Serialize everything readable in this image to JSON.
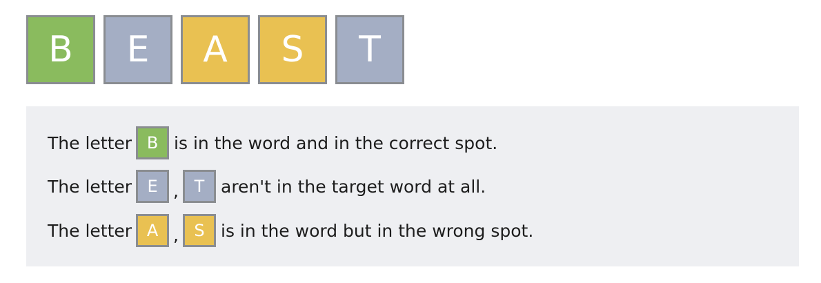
{
  "board": {
    "tiles": [
      {
        "letter": "B",
        "state": "correct"
      },
      {
        "letter": "E",
        "state": "absent"
      },
      {
        "letter": "A",
        "state": "present"
      },
      {
        "letter": "S",
        "state": "present"
      },
      {
        "letter": "T",
        "state": "absent"
      }
    ]
  },
  "colors": {
    "correct": "#8abb5e",
    "absent": "#a4aec4",
    "present": "#e9c152",
    "tile_border": "#8a8d91",
    "legend_bg": "#eeeff2"
  },
  "legend": {
    "correct": {
      "prefix": "The letter",
      "letters": [
        "B"
      ],
      "text": "is in the word and in the correct spot."
    },
    "absent": {
      "prefix": "The letter",
      "letters": [
        "E",
        "T"
      ],
      "separator": ",",
      "text": "aren't in the target word at all."
    },
    "present": {
      "prefix": "The letter",
      "letters": [
        "A",
        "S"
      ],
      "separator": ",",
      "text": "is in the word but in the wrong spot."
    }
  }
}
